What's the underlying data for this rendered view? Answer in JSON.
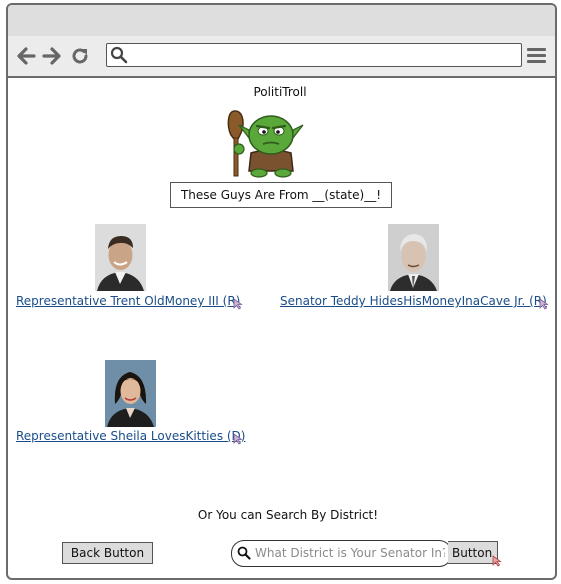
{
  "browser": {
    "address_value": "",
    "icons": [
      "back-arrow-icon",
      "forward-arrow-icon",
      "reload-icon",
      "search-icon",
      "hamburger-menu-icon"
    ]
  },
  "app": {
    "title": "PolitiTroll",
    "mascot_icon": "troll-mascot-icon",
    "state_banner": "These Guys Are From __(state)__!"
  },
  "officials": [
    {
      "name": "Representative Trent OldMoney III (R)",
      "photo": "trent-photo"
    },
    {
      "name": "Senator Teddy HidesHisMoneyInaCave Jr. (R)",
      "photo": "teddy-photo"
    },
    {
      "name": "Representative Sheila LovesKitties (D)",
      "photo": "sheila-photo"
    }
  ],
  "search": {
    "prompt": "Or You can Search By District!",
    "back_label": "Back Button",
    "placeholder": "What District is Your Senator In?",
    "value": "",
    "button_label": "Button"
  },
  "colors": {
    "link": "#1a4d88",
    "button_bg": "#dcdcdc",
    "titlebar_bg": "#dedede",
    "toolbar_bg": "#ececec",
    "troll_skin": "#5aa83a"
  }
}
